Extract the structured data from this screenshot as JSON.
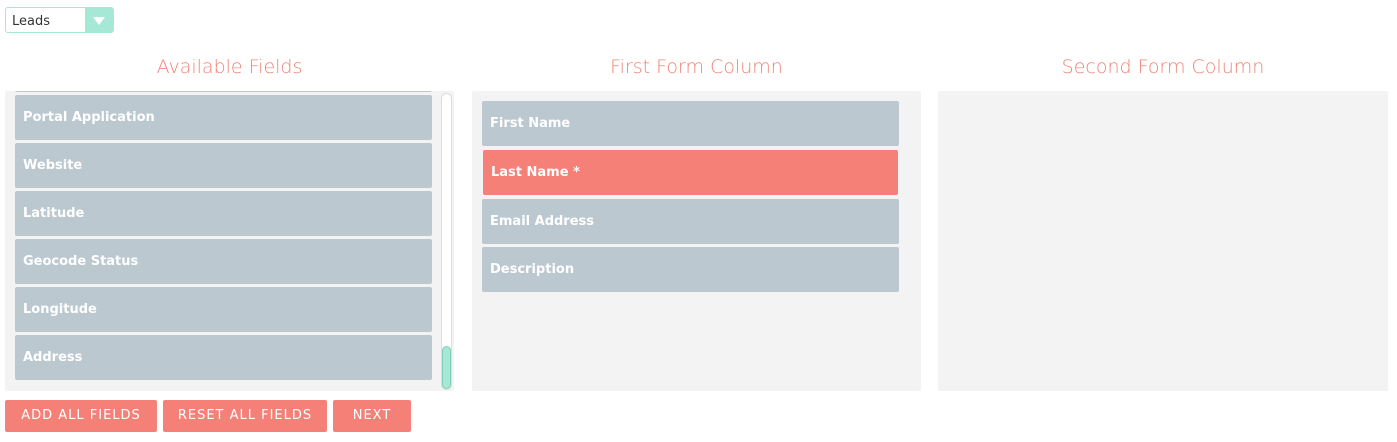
{
  "module_select": {
    "value": "Leads"
  },
  "columns": {
    "available": {
      "title": "Available Fields"
    },
    "first": {
      "title": "First Form Column"
    },
    "second": {
      "title": "Second Form Column"
    }
  },
  "available_fields": [
    "Portal Application",
    "Website",
    "Latitude",
    "Geocode Status",
    "Longitude",
    "Address"
  ],
  "first_column_fields": [
    "First Name",
    "Last Name *",
    "Email Address",
    "Description"
  ],
  "buttons": {
    "add_all": "ADD ALL FIELDS",
    "reset_all": "RESET ALL FIELDS",
    "next": "NEXT"
  },
  "colors": {
    "accent": "#f58078",
    "field_bg": "#bbc8d0",
    "select_accent": "#a5e8d6",
    "panel_bg": "#f3f3f3"
  }
}
